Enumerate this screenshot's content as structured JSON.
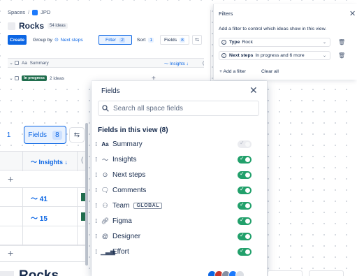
{
  "back_view": {
    "breadcrumb": {
      "spaces": "Spaces",
      "separator": "/",
      "project": "JPD"
    },
    "title": "Rocks",
    "ideas_count": "54 ideas",
    "toolbar": {
      "create": "Create",
      "group_by": "Group by",
      "group_value": "Next steps",
      "filter": "Filter",
      "filter_count": "2",
      "sort": "Sort",
      "sort_count": "1",
      "fields": "Fields",
      "fields_count": "8"
    },
    "table": {
      "summary_header": "Summary",
      "summary_icon": "Aa",
      "insights_header": "Insights ↓",
      "group_label": "In progress",
      "group_count": "2 ideas"
    }
  },
  "filters_panel": {
    "title": "Filters",
    "description": "Add a filter to control which ideas show in this view.",
    "rows": [
      {
        "field": "Type",
        "value": "Rock"
      },
      {
        "field": "Next steps",
        "value": "In progress and 6 more"
      }
    ],
    "add_filter": "+ Add a filter",
    "clear_all": "Clear all"
  },
  "zoomed_table": {
    "partial_number": "1",
    "fields_label": "Fields",
    "fields_count": "8",
    "insights_header": "Insights ↓",
    "rows": [
      {
        "value": "41"
      },
      {
        "value": "15"
      }
    ]
  },
  "fields_popup": {
    "title": "Fields",
    "search_placeholder": "Search all space fields",
    "section_title": "Fields in this view (8)",
    "items": [
      {
        "icon": "Aо",
        "label": "Summary",
        "tag": "",
        "enabled": false
      },
      {
        "icon": "insights",
        "label": "Insights",
        "tag": "",
        "enabled": true
      },
      {
        "icon": "next-steps",
        "label": "Next steps",
        "tag": "",
        "enabled": true
      },
      {
        "icon": "comments",
        "label": "Comments",
        "tag": "",
        "enabled": true
      },
      {
        "icon": "team",
        "label": "Team",
        "tag": "GLOBAL",
        "enabled": true
      },
      {
        "icon": "link",
        "label": "Figma",
        "tag": "",
        "enabled": true
      },
      {
        "icon": "at",
        "label": "Designer",
        "tag": "",
        "enabled": true
      },
      {
        "icon": "bars",
        "label": "Effort",
        "tag": "",
        "enabled": true
      }
    ]
  },
  "bottom": {
    "title": "Rocks"
  },
  "colors": {
    "accent": "#0c66e4",
    "toggle_on": "#22a06b",
    "lozenge": "#216e4e"
  }
}
